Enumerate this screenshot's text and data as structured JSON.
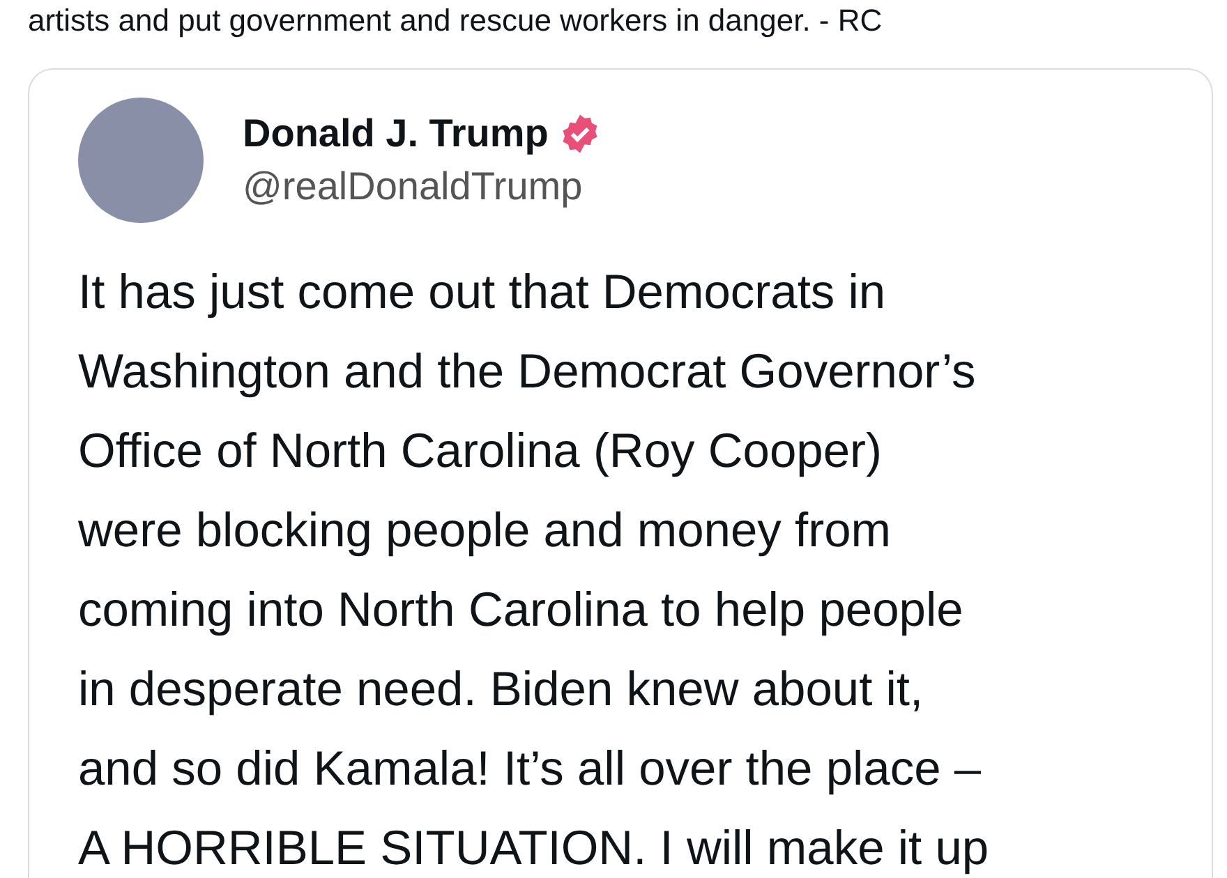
{
  "post_text": "artists and put government and rescue workers in danger. - RC",
  "quoted_post": {
    "author": {
      "name": "Donald J. Trump",
      "handle": "@realDonaldTrump",
      "verified": true
    },
    "lines": [
      "It has just come out that Democrats in",
      "Washington and the Democrat Governor’s",
      "Office of North Carolina (Roy Cooper)",
      "were blocking people and money from",
      "coming into North Carolina to help people",
      "in desperate need. Biden knew about it,",
      "and so did Kamala! It’s all over the place –",
      "A HORRIBLE SITUATION. I will make it up"
    ]
  }
}
